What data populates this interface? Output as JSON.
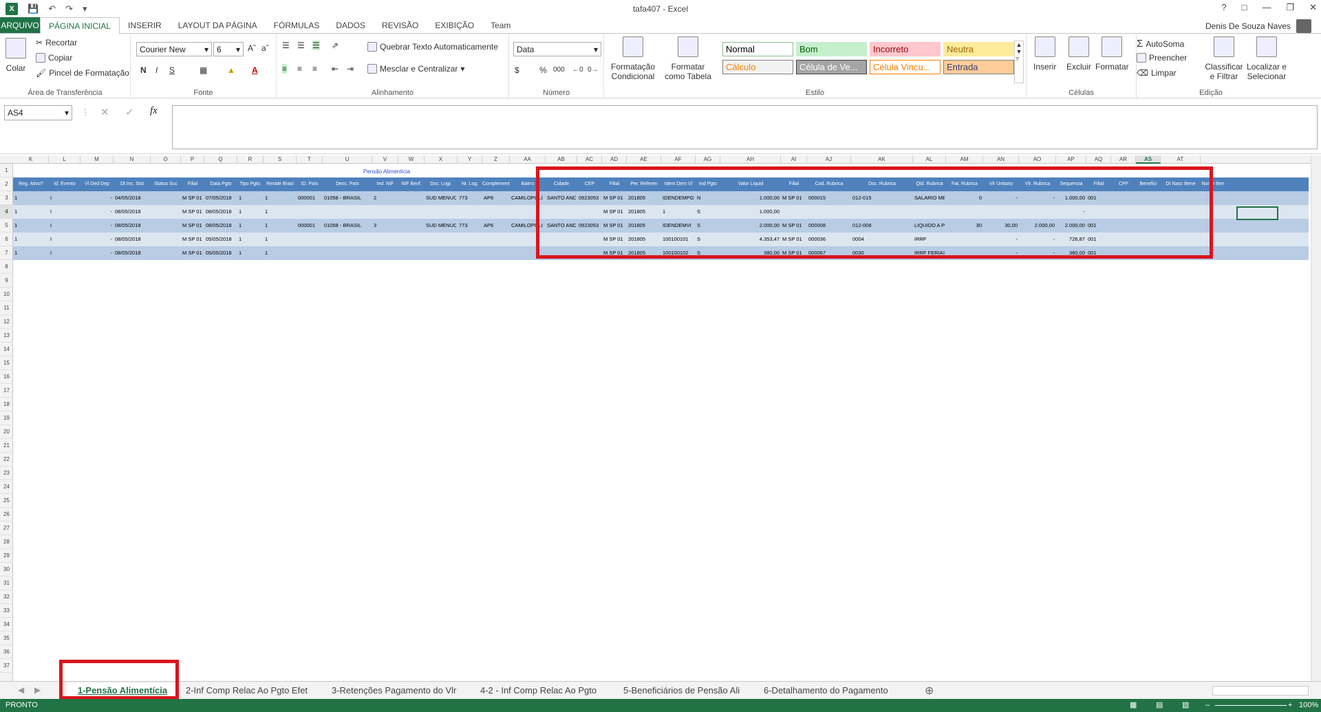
{
  "window": {
    "title": "tafa407 - Excel",
    "user": "Denis De Souza Naves"
  },
  "ribbon_tabs": [
    "ARQUIVO",
    "PÁGINA INICIAL",
    "INSERIR",
    "LAYOUT DA PÁGINA",
    "FÓRMULAS",
    "DADOS",
    "REVISÃO",
    "EXIBIÇÃO",
    "Team"
  ],
  "ribbon": {
    "clipboard": {
      "paste": "Colar",
      "cut": "Recortar",
      "copy": "Copiar",
      "painter": "Pincel de Formatação",
      "label": "Área de Transferência"
    },
    "font": {
      "name": "Courier New",
      "size": "6",
      "label": "Fonte",
      "bold": "N",
      "italic": "I",
      "underline": "S",
      "font_color": "A"
    },
    "alignment": {
      "wrap": "Quebrar Texto Automaticamente",
      "merge": "Mesclar e Centralizar",
      "label": "Alinhamento"
    },
    "number": {
      "format": "Data",
      "label": "Número",
      "percent": "%",
      "thousands": "000"
    },
    "styles": {
      "cond": "Formatação Condicional",
      "table": "Formatar como Tabela",
      "label": "Estilo",
      "cells": [
        {
          "text": "Normal",
          "bg": "#ffffff",
          "fg": "#000000",
          "border": "#8fbc8f"
        },
        {
          "text": "Bom",
          "bg": "#c6efce",
          "fg": "#006100",
          "border": "#c6efce"
        },
        {
          "text": "Incorreto",
          "bg": "#ffc7ce",
          "fg": "#9c0006",
          "border": "#ffc7ce"
        },
        {
          "text": "Neutra",
          "bg": "#ffeb9c",
          "fg": "#9c6500",
          "border": "#ffeb9c"
        },
        {
          "text": "Cálculo",
          "bg": "#f2f2f2",
          "fg": "#fa7d00",
          "border": "#7f7f7f"
        },
        {
          "text": "Célula de Ve...",
          "bg": "#a5a5a5",
          "fg": "#ffffff",
          "border": "#3f3f3f"
        },
        {
          "text": "Célula Vincu...",
          "bg": "#ffffff",
          "fg": "#fa7d00",
          "border": "#ff8001"
        },
        {
          "text": "Entrada",
          "bg": "#ffcc99",
          "fg": "#3f3f76",
          "border": "#7f7f7f"
        }
      ]
    },
    "cells": {
      "insert": "Inserir",
      "delete": "Excluir",
      "format": "Formatar",
      "label": "Células"
    },
    "editing": {
      "autosum": "AutoSoma",
      "fill": "Preencher",
      "clear": "Limpar",
      "sort": "Classificar e Filtrar",
      "find": "Localizar e Selecionar",
      "label": "Edição"
    }
  },
  "formula_bar": {
    "name_box": "AS4",
    "formula": ""
  },
  "sheet": {
    "title": "Pensão Alimentícia",
    "columns": [
      "K",
      "L",
      "M",
      "N",
      "O",
      "P",
      "Q",
      "R",
      "S",
      "T",
      "U",
      "V",
      "W",
      "X",
      "Y",
      "Z",
      "AA",
      "AB",
      "AC",
      "AD",
      "AE",
      "AF",
      "AG",
      "AH",
      "AI",
      "AJ",
      "AK",
      "AL",
      "AM",
      "AN",
      "AO",
      "AP",
      "AQ",
      "AR",
      "AS",
      "AT"
    ],
    "headers": [
      "Reg. Ativo?",
      "Id. Evento",
      "Vl Ded Dep",
      "Dt Inc. Sist",
      "Status Scc",
      "Filial",
      "Data Pgto",
      "Tipo Pgto.",
      "Reside Brasi",
      "ID. País",
      "Desc. País",
      "Ind. NIF",
      "NIF Benf.",
      "Dsc. Logr.",
      "Nr. Log.",
      "Complemento",
      "Bairro",
      "Cidade",
      "CEP",
      "Filial",
      "Per. Referen",
      "Ident Dem Vl",
      "Ind Pgto",
      "Valor Liquid",
      "Filial",
      "Cod. Rubrica",
      "Dsc. Rubrica",
      "Qtd. Rubrica",
      "Fat. Rubrica",
      "Vlr Unitario",
      "Vlr. Rubrica",
      "Sequencia",
      "Filial",
      "CPF",
      "Benefici",
      "Dt Nasc Bene",
      "Nome Ben"
    ],
    "rows": [
      [
        "1",
        "I",
        "-",
        "04/05/2018",
        "",
        "M SP 01",
        "07/05/2018",
        "1",
        "1",
        "000001",
        "01058 - BRASIL",
        "2",
        "",
        "SUD MENUC",
        "773",
        "AP6",
        "CAMILOPOLI",
        "SANTO ANDI",
        "0923053",
        "M SP 01",
        "201805",
        "IDENDEMPGT",
        "N",
        "1.000,00",
        "M SP 01",
        "000015",
        "012-015",
        "SALARIO MENSAL",
        "0",
        "-",
        "-",
        "1.000,00",
        "001"
      ],
      [
        "1",
        "I",
        "-",
        "08/05/2018",
        "",
        "M SP 01",
        "08/05/2018",
        "1",
        "1",
        "",
        "",
        "",
        "",
        "",
        "",
        "",
        "",
        "",
        "",
        "M SP 01",
        "201805",
        "1",
        "S",
        "1.000,00",
        "",
        "",
        "",
        "",
        "",
        "",
        "",
        "-",
        ""
      ],
      [
        "1",
        "I",
        "-",
        "08/05/2018",
        "",
        "M SP 01",
        "08/05/2018",
        "1",
        "1",
        "000001",
        "01058 - BRASIL",
        "3",
        "",
        "SUD MENUC",
        "773",
        "AP6",
        "CAMILOPOLI",
        "SANTO ANDI",
        "0923053",
        "M SP 01",
        "201805",
        "IDENDEMVI",
        "S",
        "2.000,00",
        "M SP 01",
        "000008",
        "012-008",
        "LIQUIDO A PAGAR",
        "30",
        "30,00",
        "2.000,00",
        "2.000,00",
        "001"
      ],
      [
        "1",
        "I",
        "-",
        "08/05/2018",
        "",
        "M SP 01",
        "05/05/2018",
        "1",
        "1",
        "",
        "",
        "",
        "",
        "",
        "",
        "",
        "",
        "",
        "",
        "M SP 01",
        "201805",
        "100100101",
        "S",
        "4.353,47",
        "M SP 01",
        "000036",
        "0004",
        "IRRF",
        "",
        "-",
        "-",
        "726,87",
        "001"
      ],
      [
        "1",
        "I",
        "-",
        "08/05/2018",
        "",
        "M SP 01",
        "05/05/2018",
        "1",
        "1",
        "",
        "",
        "",
        "",
        "",
        "",
        "",
        "",
        "",
        "",
        "M SP 01",
        "201805",
        "100100102",
        "S",
        "380,00",
        "M SP 01",
        "000067",
        "0030",
        "IRRF FERIAS",
        "",
        "-",
        "-",
        "380,00",
        "001"
      ]
    ]
  },
  "sheet_tabs": [
    "1-Pensão Alimentícia",
    "2-Inf Comp Relac Ao Pgto Efet",
    "3-Retenções Pagamento do Vlr",
    "4-2 - Inf Comp Relac Ao Pgto",
    "5-Beneficiários de Pensão Ali",
    "6-Detalhamento do Pagamento"
  ],
  "status": {
    "left": "PRONTO",
    "zoom": "100%"
  },
  "colors": {
    "excel_green": "#217346",
    "highlight_red": "#d9151d",
    "table_header": "#4f81bd"
  }
}
